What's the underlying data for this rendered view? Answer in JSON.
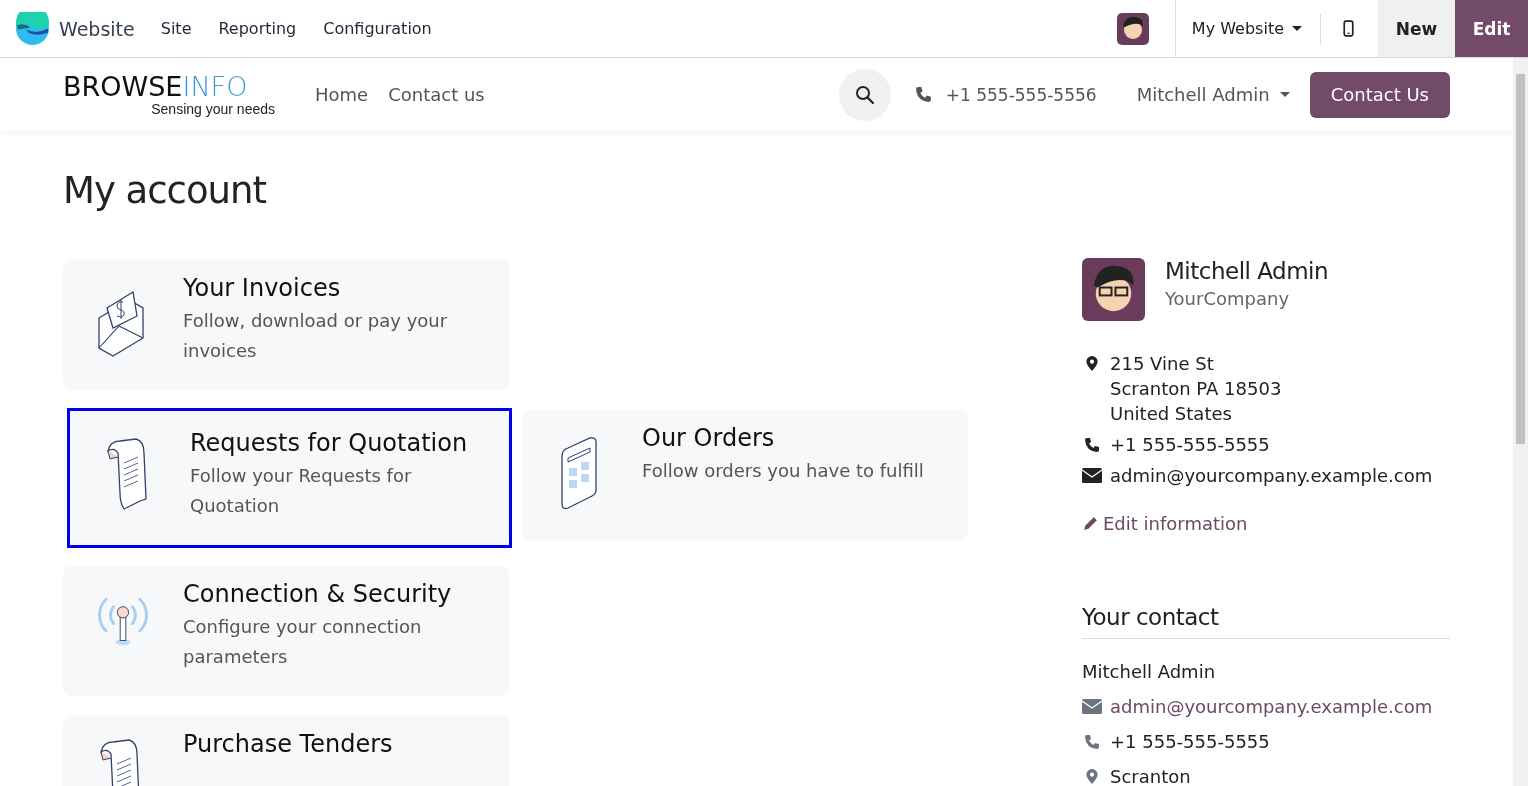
{
  "top_bar": {
    "app_name": "Website",
    "menu": [
      "Site",
      "Reporting",
      "Configuration"
    ],
    "website_selector": "My Website",
    "new_button": "New",
    "edit_button": "Edit"
  },
  "header": {
    "logo_word_dark": "BROWSE",
    "logo_word_light": "INFO",
    "tagline": "Sensing your needs",
    "nav": [
      "Home",
      "Contact us"
    ],
    "phone": "+1 555-555-5556",
    "user": "Mitchell Admin",
    "cta": "Contact Us"
  },
  "page_title": "My account",
  "card_rows": [
    [
      {
        "kind": "invoice",
        "title": "Your Invoices",
        "description": "Follow, download or pay your invoices",
        "highlighted": false
      }
    ],
    [
      {
        "kind": "quotation",
        "title": "Requests for Quotation",
        "description": "Follow your Requests for Quotation",
        "highlighted": true
      },
      {
        "kind": "orders",
        "title": "Our Orders",
        "description": "Follow orders you have to fulfill",
        "highlighted": false
      }
    ],
    [
      {
        "kind": "security",
        "title": "Connection & Security",
        "description": "Configure your connection parameters",
        "highlighted": false
      }
    ],
    [
      {
        "kind": "quotation",
        "title": "Purchase Tenders",
        "highlighted": false
      }
    ]
  ],
  "profile": {
    "name": "Mitchell Admin",
    "company": "YourCompany",
    "address": [
      "215 Vine St",
      "Scranton PA 18503",
      "United States"
    ],
    "phone": "+1 555-555-5555",
    "email": "admin@yourcompany.example.com",
    "edit_link": "Edit information"
  },
  "your_contact": {
    "heading": "Your contact",
    "name": "Mitchell Admin",
    "email": "admin@yourcompany.example.com",
    "phone": "+1 555-555-5555",
    "city": "Scranton"
  }
}
